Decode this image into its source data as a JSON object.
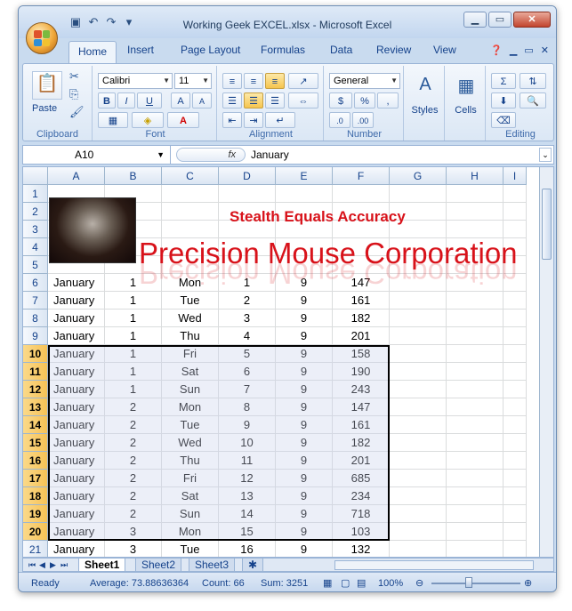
{
  "window": {
    "title": "Working Geek EXCEL.xlsx - Microsoft Excel",
    "controls": [
      "minimize",
      "maximize",
      "close"
    ]
  },
  "quick_access": [
    "save-icon",
    "undo-icon",
    "redo-icon",
    "customize-icon"
  ],
  "ribbon_tabs": [
    "Home",
    "Insert",
    "Page Layout",
    "Formulas",
    "Data",
    "Review",
    "View"
  ],
  "ribbon": {
    "clipboard": {
      "label": "Clipboard",
      "paste": "Paste"
    },
    "font": {
      "label": "Font",
      "name": "Calibri",
      "size": "11"
    },
    "alignment": {
      "label": "Alignment"
    },
    "number": {
      "label": "Number",
      "format": "General"
    },
    "styles": {
      "label": "Styles"
    },
    "cells": {
      "label": "Cells"
    },
    "editing": {
      "label": "Editing"
    }
  },
  "formula_bar": {
    "name_box": "A10",
    "fx": "fx",
    "value": "January"
  },
  "columns": [
    "A",
    "B",
    "C",
    "D",
    "E",
    "F",
    "G",
    "H",
    "I"
  ],
  "row_numbers": [
    "1",
    "2",
    "3",
    "4",
    "5",
    "6",
    "7",
    "8",
    "9",
    "10",
    "11",
    "12",
    "13",
    "14",
    "15",
    "16",
    "17",
    "18",
    "19",
    "20",
    "21"
  ],
  "banner": {
    "slogan": "Stealth Equals Accuracy",
    "company": "Precision Mouse Corporation"
  },
  "rows": [
    [
      "January",
      "1",
      "Mon",
      "1",
      "9",
      "147"
    ],
    [
      "January",
      "1",
      "Tue",
      "2",
      "9",
      "161"
    ],
    [
      "January",
      "1",
      "Wed",
      "3",
      "9",
      "182"
    ],
    [
      "January",
      "1",
      "Thu",
      "4",
      "9",
      "201"
    ],
    [
      "January",
      "1",
      "Fri",
      "5",
      "9",
      "158"
    ],
    [
      "January",
      "1",
      "Sat",
      "6",
      "9",
      "190"
    ],
    [
      "January",
      "1",
      "Sun",
      "7",
      "9",
      "243"
    ],
    [
      "January",
      "2",
      "Mon",
      "8",
      "9",
      "147"
    ],
    [
      "January",
      "2",
      "Tue",
      "9",
      "9",
      "161"
    ],
    [
      "January",
      "2",
      "Wed",
      "10",
      "9",
      "182"
    ],
    [
      "January",
      "2",
      "Thu",
      "11",
      "9",
      "201"
    ],
    [
      "January",
      "2",
      "Fri",
      "12",
      "9",
      "685"
    ],
    [
      "January",
      "2",
      "Sat",
      "13",
      "9",
      "234"
    ],
    [
      "January",
      "2",
      "Sun",
      "14",
      "9",
      "718"
    ],
    [
      "January",
      "3",
      "Mon",
      "15",
      "9",
      "103"
    ],
    [
      "January",
      "3",
      "Tue",
      "16",
      "9",
      "132"
    ]
  ],
  "sheets": [
    "Sheet1",
    "Sheet2",
    "Sheet3"
  ],
  "status": {
    "mode": "Ready",
    "average": "Average: 73.88636364",
    "count": "Count: 66",
    "sum": "Sum: 3251",
    "zoom": "100%"
  }
}
